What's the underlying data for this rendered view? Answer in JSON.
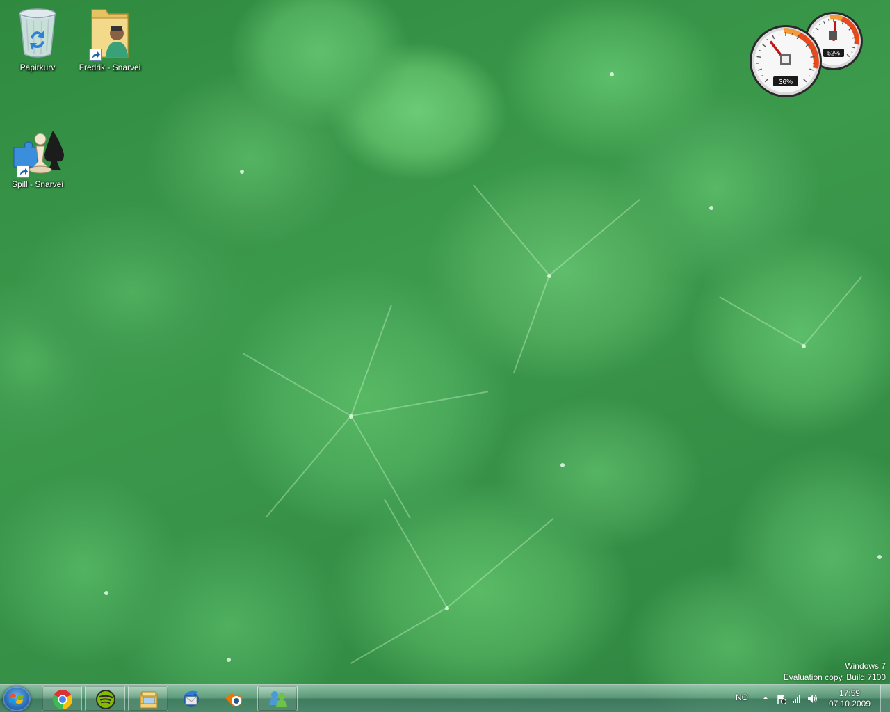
{
  "desktop": {
    "icons": [
      {
        "label": "Papirkurv",
        "icon": "recycle-bin-icon"
      },
      {
        "label": "Fredrik - Snarvei",
        "icon": "user-folder-icon"
      },
      {
        "label": "Spill - Snarvei",
        "icon": "games-icon"
      }
    ]
  },
  "gadget": {
    "cpu_percent": "36%",
    "memory_percent": "52%",
    "cpu_value": 36,
    "memory_value": 52
  },
  "watermark": {
    "line1": "Windows 7",
    "line2": "Evaluation copy. Build 7100"
  },
  "taskbar": {
    "start": "start-orb-icon",
    "pinned": [
      {
        "name": "chrome",
        "icon": "chrome-icon",
        "active": true
      },
      {
        "name": "spotify",
        "icon": "spotify-icon",
        "active": true
      },
      {
        "name": "explorer",
        "icon": "explorer-icon",
        "active": true
      },
      {
        "name": "thunderbird",
        "icon": "thunderbird-icon",
        "active": false
      },
      {
        "name": "blender",
        "icon": "blender-icon",
        "active": false
      },
      {
        "name": "messenger",
        "icon": "messenger-icon",
        "active": true
      }
    ],
    "tray": {
      "language": "NO",
      "time": "17:59",
      "date": "07.10.2009"
    }
  }
}
